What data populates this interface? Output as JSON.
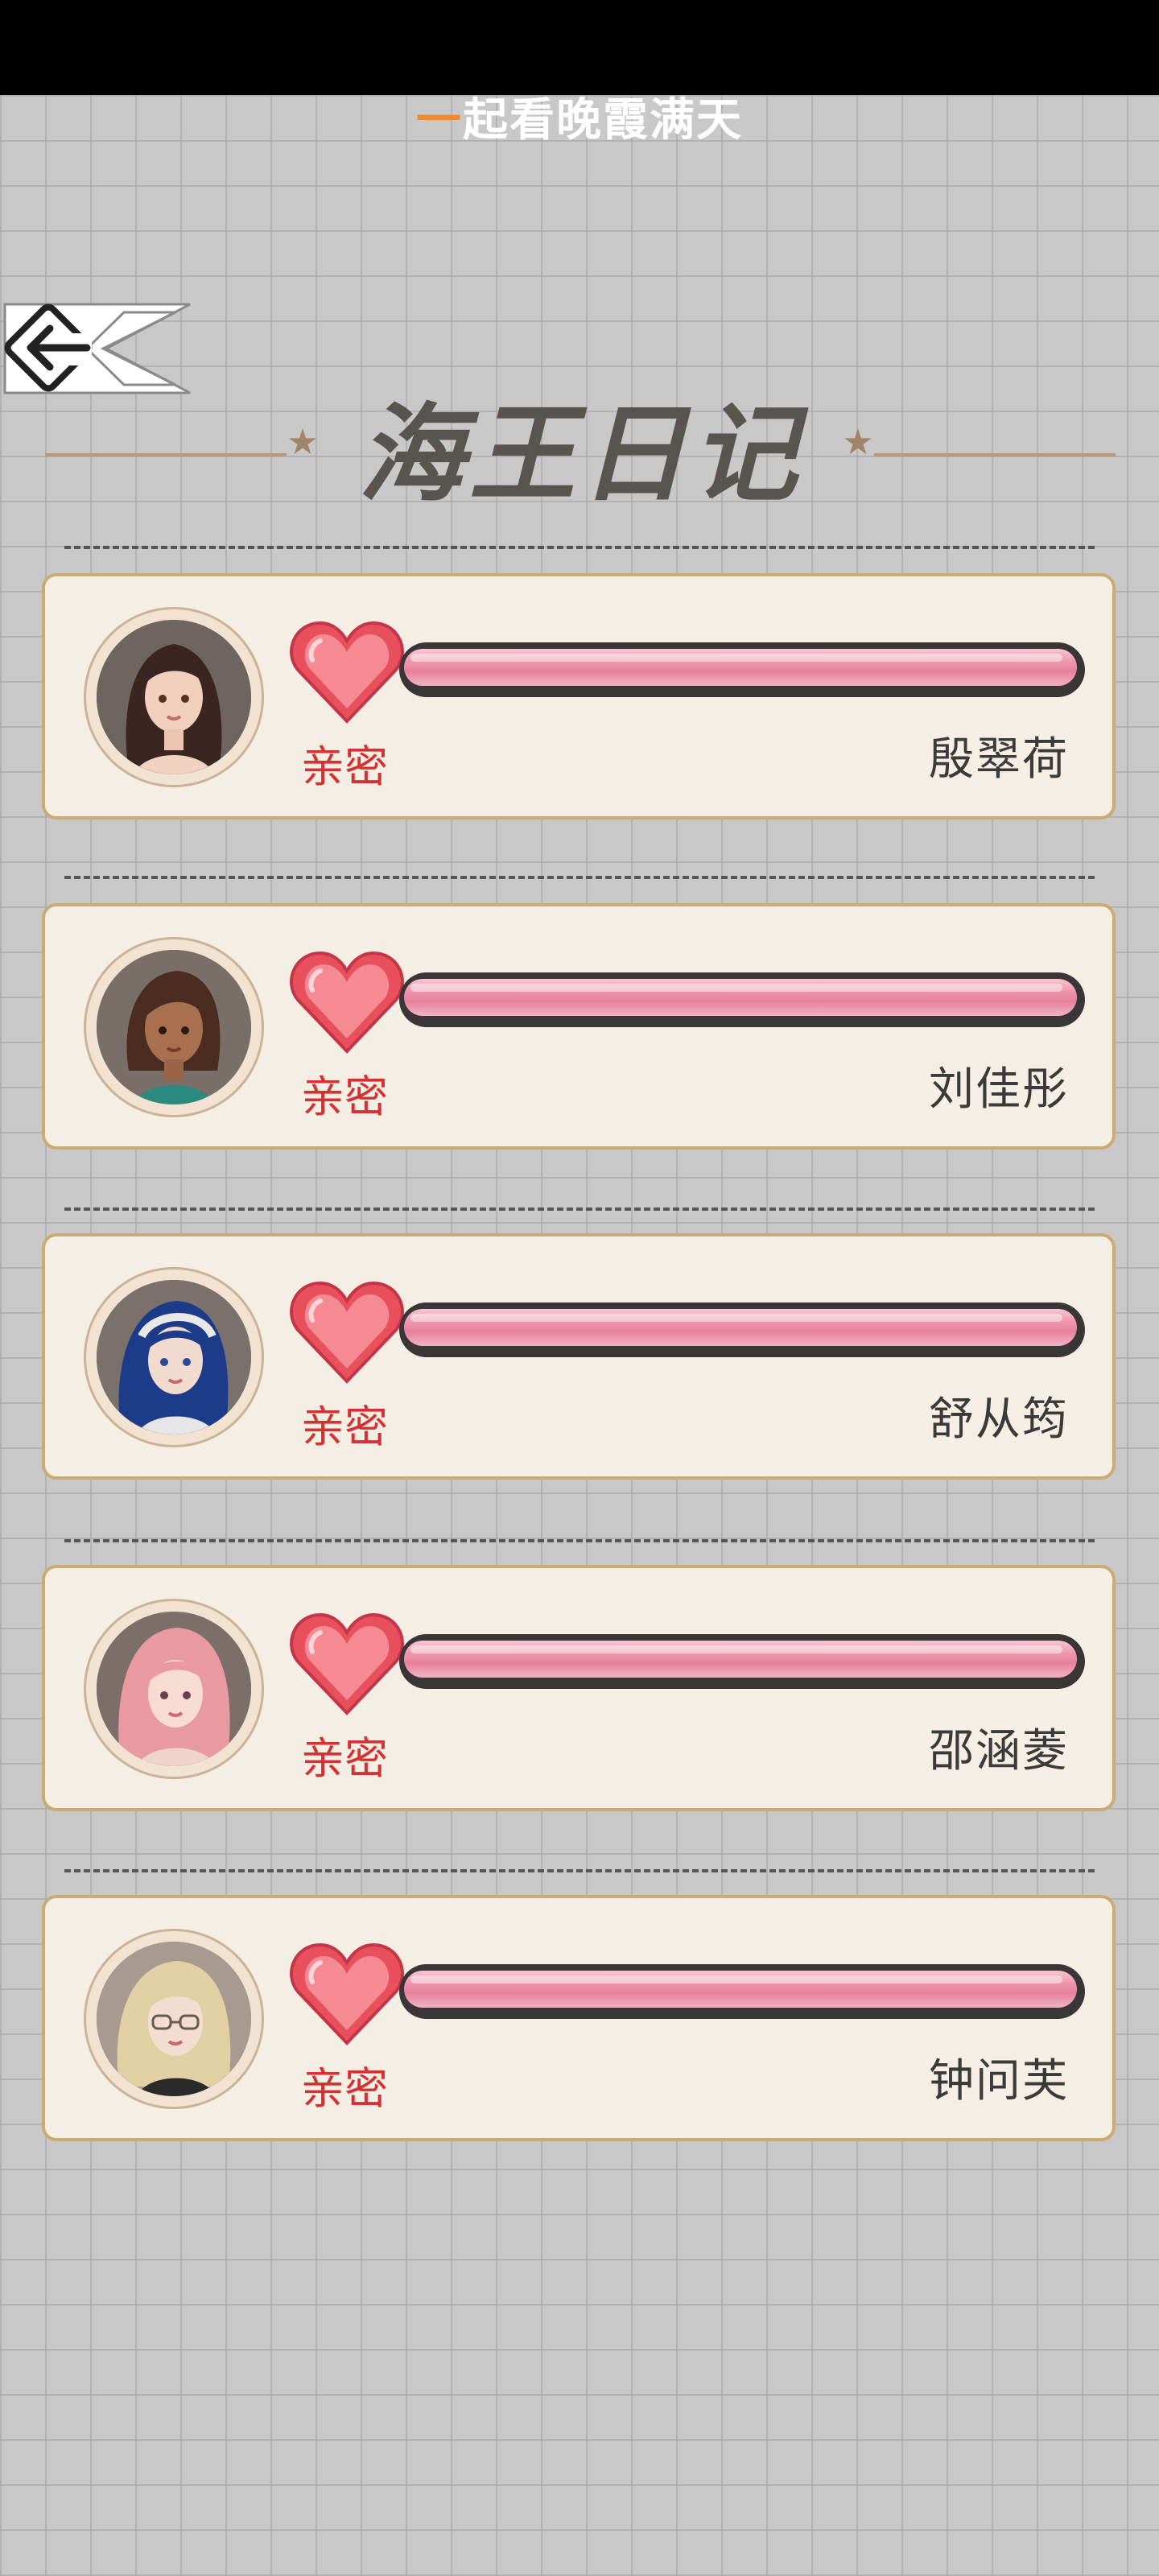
{
  "header": {
    "subtitle_first": "一",
    "subtitle_rest": "起看晚霞满天",
    "title": "海王日记"
  },
  "colors": {
    "card_background": "#f5eee4",
    "card_border": "#c8ac74",
    "intimacy_label": "#d43232",
    "bar_fill": "#ee96ad",
    "heart": "#e84c5c"
  },
  "icons": {
    "back": "back-arrow-icon",
    "heart": "heart-icon",
    "star": "star-icon"
  },
  "characters": [
    {
      "name": "殷翠荷",
      "intimacy_label": "亲密",
      "intimacy_progress": 1.0
    },
    {
      "name": "刘佳彤",
      "intimacy_label": "亲密",
      "intimacy_progress": 1.0
    },
    {
      "name": "舒从筠",
      "intimacy_label": "亲密",
      "intimacy_progress": 1.0
    },
    {
      "name": "邵涵菱",
      "intimacy_label": "亲密",
      "intimacy_progress": 1.0
    },
    {
      "name": "钟问芙",
      "intimacy_label": "亲密",
      "intimacy_progress": 1.0
    }
  ]
}
